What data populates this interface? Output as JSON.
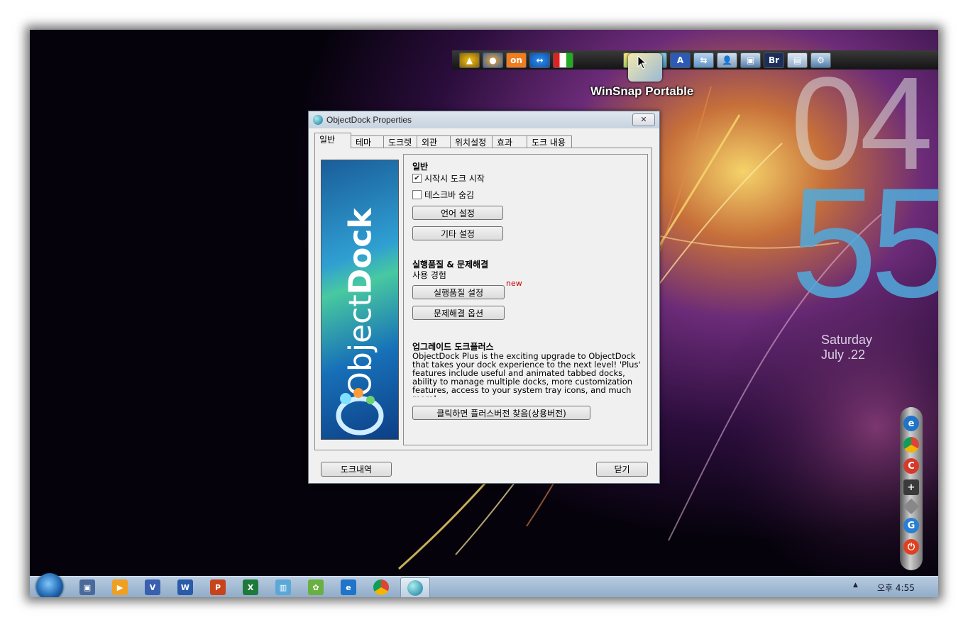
{
  "desktop": {
    "dock_tooltip": "WinSnap Portable",
    "top_dock_icons": [
      "daum-potplayer-icon",
      "firefox-icon",
      "eon-icon",
      "teamviewer-icon",
      "bandizip-icon",
      "winsnap-icon",
      "notepad-icon",
      "usb-icon",
      "a-icon",
      "network-icon",
      "user-icon",
      "computer-icon",
      "br-icon",
      "explorer-icon",
      "settings-icon"
    ],
    "clock": {
      "hour": "04",
      "minute": "55",
      "day": "Saturday",
      "date": "July .22"
    },
    "side_dock_icons": [
      "ie-icon",
      "chrome-icon",
      "ccleaner-icon",
      "monitor-icon",
      "diamond-icon",
      "browser-icon",
      "power-icon"
    ]
  },
  "dialog": {
    "title": "ObjectDock Properties",
    "close_label": "✕",
    "tabs": [
      "일반",
      "테마",
      "도크렛",
      "외관",
      "위치설정",
      "효과",
      "도크 내용"
    ],
    "banner_text_light": "Object",
    "banner_text_bold": "Dock",
    "general": {
      "heading": "일반",
      "start_on_boot": "시작시 도크 시작",
      "start_on_boot_checked": true,
      "hide_taskbar": "테스크바 숨김",
      "hide_taskbar_checked": false,
      "language_button": "언어 설정",
      "other_button": "기타 설정"
    },
    "quality": {
      "heading": "실행품질 & 문제해결",
      "subheading": "사용 경험",
      "quality_button": "실행품질 설정",
      "new_badge": "new",
      "troubleshoot_button": "문제해결 옵션"
    },
    "upgrade": {
      "heading": "업그레이드 도크플러스",
      "body": "ObjectDock Plus is the exciting upgrade to ObjectDock that takes your dock experience to the next level!  'Plus' features include useful and animated tabbed docks, ability to manage multiple docks, more customization features, access to your system tray icons, and much more!",
      "button": "클릭하면 플러스버전 찾음(상용버전)"
    },
    "history_button": "도크내역",
    "close_button": "닫기"
  },
  "taskbar": {
    "icons": [
      "network-icon",
      "media-player-icon",
      "visio-icon",
      "word-icon",
      "powerpoint-icon",
      "excel-icon",
      "archive-icon",
      "frog-icon",
      "ie-icon",
      "chrome-icon",
      "objectdock-icon"
    ],
    "clock": "오후 4:55",
    "tray_arrow": "▲"
  },
  "colors": {
    "accent_blue": "#4fb3e6",
    "new_badge": "#c00000",
    "taskbar": "#a9c0d8"
  }
}
